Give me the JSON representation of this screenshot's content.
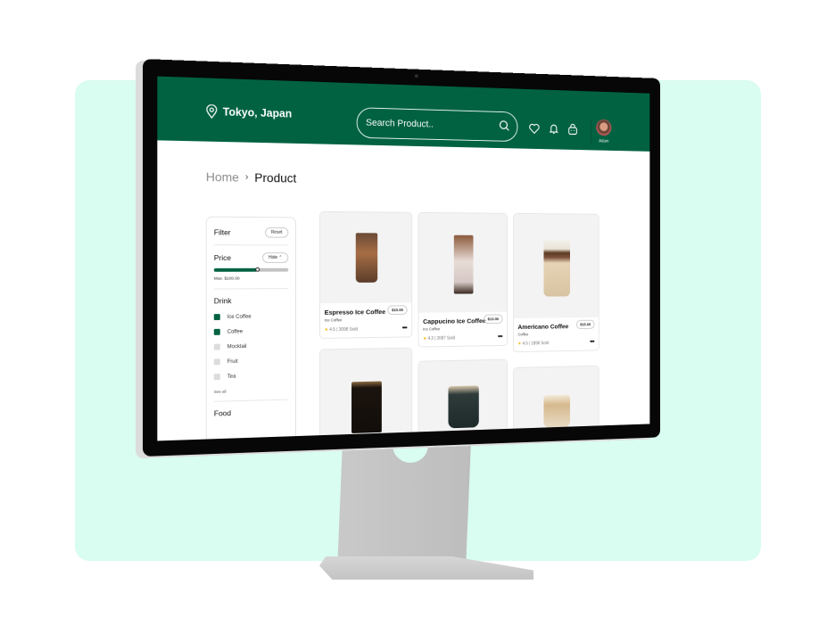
{
  "header": {
    "location": "Tokyo, Japan",
    "search_placeholder": "Search Product..",
    "user_name": "Adam",
    "brand_color": "#006241"
  },
  "breadcrumb": {
    "home": "Home",
    "separator": "›",
    "current": "Product"
  },
  "filter": {
    "title": "Filter",
    "reset_label": "Reset",
    "price": {
      "title": "Price",
      "toggle_label": "Hide",
      "max_label": "Max. $100.00",
      "slider_fraction": 0.58
    },
    "drink": {
      "title": "Drink",
      "options": [
        {
          "label": "Ice Coffee",
          "checked": true
        },
        {
          "label": "Coffee",
          "checked": true
        },
        {
          "label": "Mocktail",
          "checked": false
        },
        {
          "label": "Fruit",
          "checked": false
        },
        {
          "label": "Tea",
          "checked": false
        }
      ],
      "see_all": "See all"
    },
    "food_title": "Food"
  },
  "products": [
    {
      "name": "Espresso Ice Coffee",
      "category": "Ice Coffee",
      "price": "$10.00",
      "rating": "4.5",
      "sold": "3098 Sold"
    },
    {
      "name": "Cappucino Ice Coffee",
      "category": "Ice Coffee",
      "price": "$13.00",
      "rating": "4.3",
      "sold": "2087 Sold"
    },
    {
      "name": "Americano Coffee",
      "category": "Coffee",
      "price": "$15.00",
      "rating": "4.5",
      "sold": "1898 Sold"
    }
  ],
  "icons": {
    "star": "★",
    "more": "•••"
  }
}
